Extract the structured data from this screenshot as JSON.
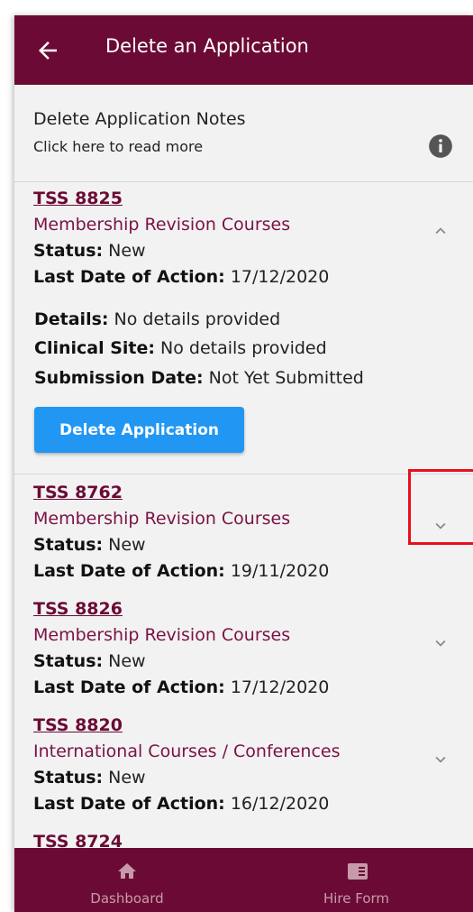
{
  "appbar": {
    "title": "Delete an Application",
    "back_icon": "arrow-left-icon"
  },
  "notes": {
    "title": "Delete Application Notes",
    "subtitle": "Click here to read more",
    "icon": "info-icon"
  },
  "labels": {
    "status": "Status:",
    "last_date": "Last Date of Action:",
    "details": "Details:",
    "clinical_site": "Clinical Site:",
    "submission_date": "Submission Date:"
  },
  "applications": [
    {
      "id": "TSS 8825",
      "course": "Membership Revision Courses",
      "status": "New",
      "last_date": "17/12/2020",
      "expanded": true,
      "details": "No details provided",
      "clinical_site": "No details provided",
      "submission_date": "Not Yet Submitted",
      "delete_label": "Delete Application"
    },
    {
      "id": "TSS 8762",
      "course": "Membership Revision Courses",
      "status": "New",
      "last_date": "19/11/2020",
      "expanded": false
    },
    {
      "id": "TSS 8826",
      "course": "Membership Revision Courses",
      "status": "New",
      "last_date": "17/12/2020",
      "expanded": false
    },
    {
      "id": "TSS 8820",
      "course": "International Courses / Conferences",
      "status": "New",
      "last_date": "16/12/2020",
      "expanded": false
    },
    {
      "id": "TSS 8724"
    }
  ],
  "bottom_nav": [
    {
      "label": "Dashboard",
      "icon": "home-icon"
    },
    {
      "label": "Hire Form",
      "icon": "form-icon"
    }
  ],
  "colors": {
    "primary": "#6b0b35",
    "accent": "#2196f3",
    "highlight": "#e8101c",
    "background": "#f2f2f2"
  }
}
